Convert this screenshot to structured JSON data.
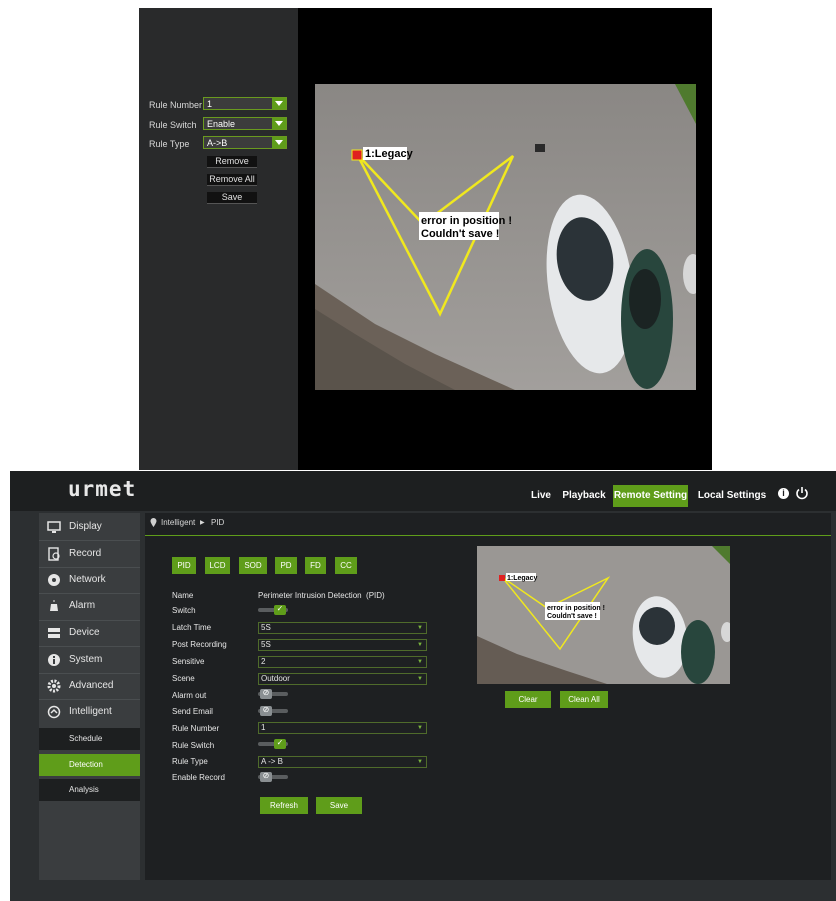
{
  "popup": {
    "fields": [
      {
        "label": "Rule Number",
        "value": "1"
      },
      {
        "label": "Rule Switch",
        "value": "Enable"
      },
      {
        "label": "Rule Type",
        "value": "A->B"
      }
    ],
    "buttons": [
      "Remove",
      "Remove All",
      "Save"
    ],
    "overlay": {
      "rule_tag": "1:Legacy",
      "error_line1": "error in position !",
      "error_line2": "Couldn't save !"
    }
  },
  "header": {
    "logo": "urmet",
    "nav": [
      "Live",
      "Playback",
      "Remote Setting",
      "Local Settings"
    ],
    "active_nav": "Remote Setting"
  },
  "sidebar": {
    "items": [
      "Display",
      "Record",
      "Network",
      "Alarm",
      "Device",
      "System",
      "Advanced",
      "Intelligent"
    ],
    "sub_items": [
      "Schedule",
      "Detection",
      "Analysis"
    ],
    "active_sub": "Detection"
  },
  "breadcrumb": {
    "section": "Intelligent",
    "page": "PID"
  },
  "tabs": [
    "PID",
    "LCD",
    "SOD",
    "PD",
    "FD",
    "CC"
  ],
  "form": {
    "name_label": "Name",
    "name_value": "Perimeter Intrusion Detection  (PID)",
    "switch_label": "Switch",
    "latch_label": "Latch Time",
    "latch_value": "5S",
    "post_label": "Post Recording",
    "post_value": "5S",
    "sensitive_label": "Sensitive",
    "sensitive_value": "2",
    "scene_label": "Scene",
    "scene_value": "Outdoor",
    "alarm_label": "Alarm out",
    "email_label": "Send Email",
    "rule_number_label": "Rule Number",
    "rule_number_value": "1",
    "rule_switch_label": "Rule Switch",
    "rule_type_label": "Rule Type",
    "rule_type_value": "A -> B",
    "enable_record_label": "Enable Record",
    "switch_on": true,
    "alarm_on": false,
    "email_on": false,
    "rule_switch_on": true,
    "record_on": false
  },
  "buttons": {
    "clear": "Clear",
    "clean_all": "Clean All",
    "refresh": "Refresh",
    "save": "Save"
  },
  "colors": {
    "accent": "#5f9d1a",
    "rule_line": "#f0e81e"
  }
}
